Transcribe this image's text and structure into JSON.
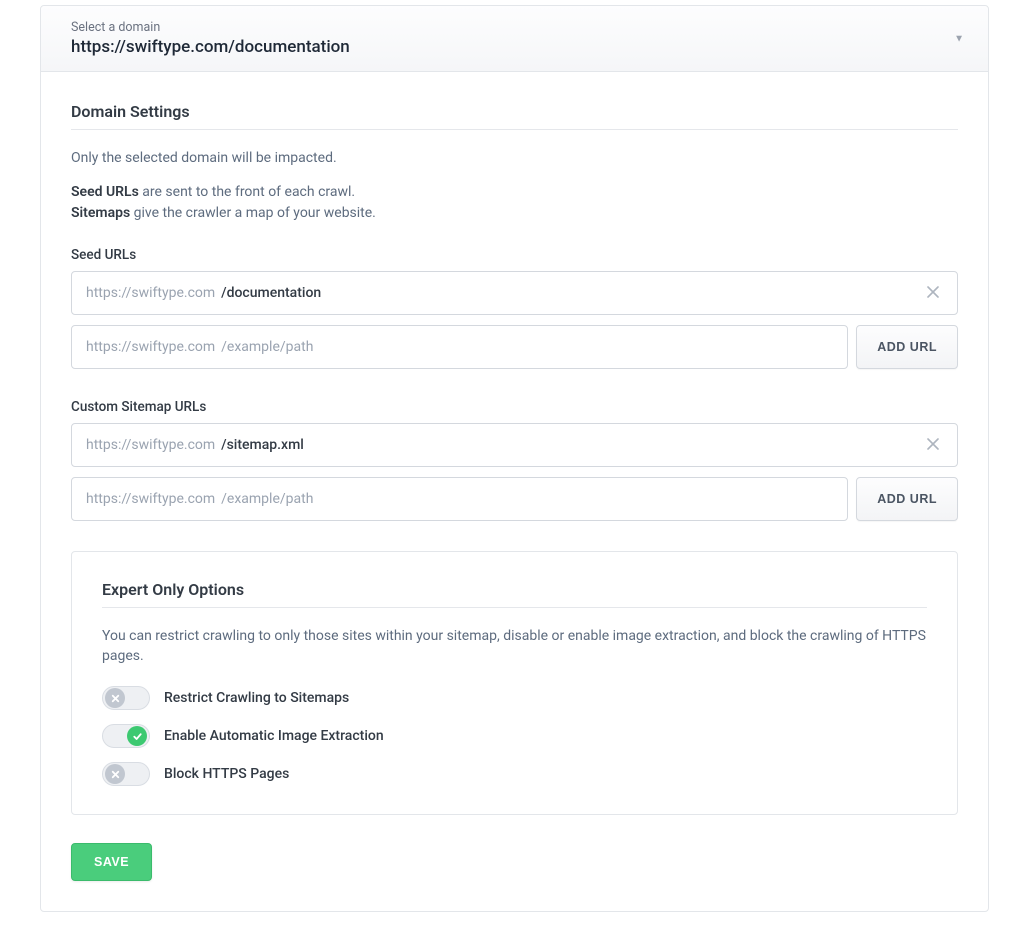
{
  "domain_selector": {
    "label": "Select a domain",
    "value": "https://swiftype.com/documentation"
  },
  "section": {
    "title": "Domain Settings",
    "subtitle": "Only the selected domain will be impacted.",
    "seed_label": "Seed URLs",
    "seed_desc_suffix": " are sent to the front of each crawl.",
    "sitemap_label": "Sitemaps",
    "sitemap_desc_suffix": " give the crawler a map of your website."
  },
  "seed_urls": {
    "heading": "Seed URLs",
    "prefix": "https://swiftype.com",
    "entries": [
      {
        "path": "/documentation"
      }
    ],
    "placeholder": "/example/path",
    "add_button": "ADD URL"
  },
  "sitemap_urls": {
    "heading": "Custom Sitemap URLs",
    "prefix": "https://swiftype.com",
    "entries": [
      {
        "path": "/sitemap.xml"
      }
    ],
    "placeholder": "/example/path",
    "add_button": "ADD URL"
  },
  "expert": {
    "title": "Expert Only Options",
    "desc": "You can restrict crawling to only those sites within your sitemap, disable or enable image extraction, and block the crawling of HTTPS pages.",
    "toggles": [
      {
        "label": "Restrict Crawling to Sitemaps",
        "on": false
      },
      {
        "label": "Enable Automatic Image Extraction",
        "on": true
      },
      {
        "label": "Block HTTPS Pages",
        "on": false
      }
    ]
  },
  "save_label": "SAVE"
}
